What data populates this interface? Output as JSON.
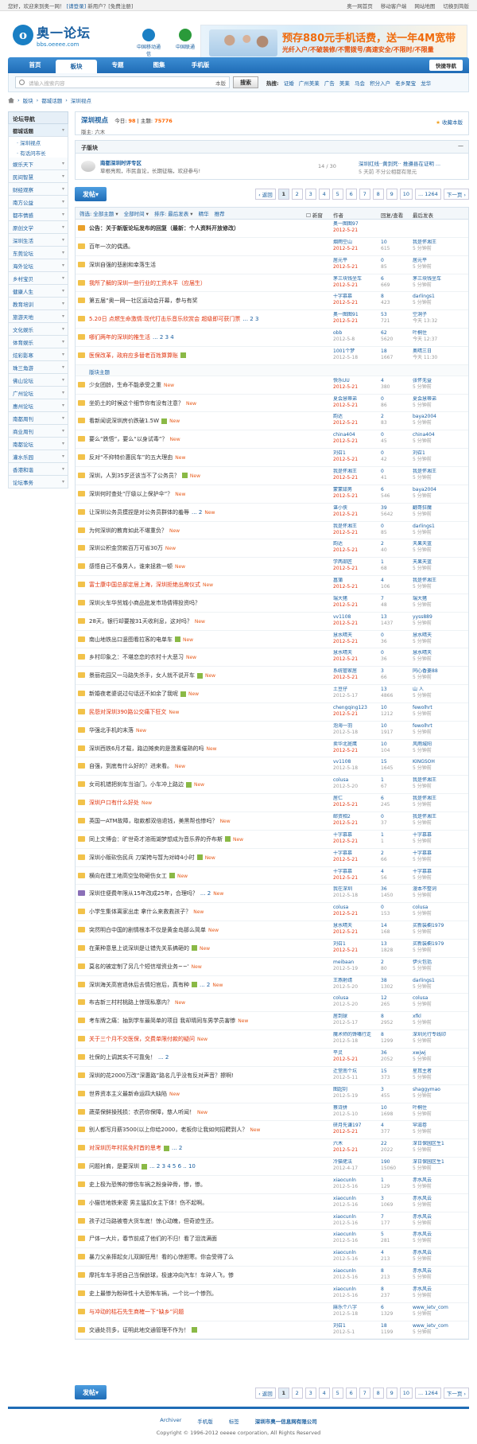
{
  "topbar": {
    "greeting": "您好，欢迎来到奥一网！",
    "login": "[请登录]",
    "new_user": "新用户？[免费注册]",
    "links": [
      "奥一网首页",
      "移动客户端",
      "网站地图",
      "切换到简版"
    ]
  },
  "logo": {
    "name": "奥一论坛",
    "url": "bbs.oeeee.com"
  },
  "partners": [
    "中国移动通信",
    "中国联通"
  ],
  "banner": {
    "line1": "预存880元手机话费，送一年4M宽带",
    "line2": "光纤入户/不破装修/不需拨号/高速安全/不限时/不限量"
  },
  "nav": {
    "items": [
      "首页",
      "板块",
      "专题",
      "图集",
      "手机版"
    ],
    "active": 1,
    "quick": "快捷导航"
  },
  "search": {
    "placeholder": "请输入搜索内容",
    "scope": "本版",
    "button": "搜索",
    "hot_label": "热搜:",
    "hot": [
      "证婚",
      "广州美莱",
      "广告",
      "美莱",
      "马会",
      "积分入户",
      "老乡聚宝",
      "龙华"
    ]
  },
  "breadcrumb": [
    "版块",
    "都城话题",
    "深圳视点"
  ],
  "sidebar": {
    "title": "论坛导航",
    "items": [
      {
        "label": "都城话题",
        "selected": true,
        "subs": [
          "深圳视点",
          "有话问市长"
        ]
      },
      {
        "label": "娱乐天下"
      },
      {
        "label": "民间智慧"
      },
      {
        "label": "财经观察"
      },
      {
        "label": "南方公益"
      },
      {
        "label": "都市情感"
      },
      {
        "label": "原创文学"
      },
      {
        "label": "深圳生活"
      },
      {
        "label": "东莞论坛"
      },
      {
        "label": "海外论坛"
      },
      {
        "label": "乡村宝贝"
      },
      {
        "label": "健康人生"
      },
      {
        "label": "教育培训"
      },
      {
        "label": "旅游天地"
      },
      {
        "label": "文化娱乐"
      },
      {
        "label": "体育娱乐"
      },
      {
        "label": "炫彩影寒"
      },
      {
        "label": "珠三角游"
      },
      {
        "label": "佛山论坛"
      },
      {
        "label": "广州论坛"
      },
      {
        "label": "惠州论坛"
      },
      {
        "label": "南都周刊"
      },
      {
        "label": "商业周刊"
      },
      {
        "label": "南都论坛"
      },
      {
        "label": "灌水乐园"
      },
      {
        "label": "香港和谐"
      },
      {
        "label": "论坛事务"
      }
    ]
  },
  "forum": {
    "title": "深圳视点",
    "today_label": "今日:",
    "today": "98",
    "topics_label": "主题:",
    "topics": "75776",
    "mods": "版主: 六木",
    "fav": "收藏本版"
  },
  "subforum": {
    "header": "子版块",
    "name": "南都深圳时评专区",
    "desc": "草根亮观，市民直论，长期征稿，欢迎参与!",
    "count": "14 / 30",
    "last1": "深圳红线··黄到死·· 推遵县在证明 ...",
    "last2": "5 天前 不分公相都有限元"
  },
  "post_btn": "发帖",
  "pager": [
    "‹ 返回",
    "1",
    "2",
    "3",
    "4",
    "5",
    "6",
    "7",
    "8",
    "9",
    "10",
    "... 1264",
    "下一页 ›"
  ],
  "filter": {
    "items": [
      "筛选: 全部主题",
      "全部时间",
      "排序: 最后发表",
      "精华",
      "推荐"
    ],
    "new_label": "新窗",
    "cols": [
      "作者",
      "回复/查看",
      "最后发表"
    ]
  },
  "divider": "版块主题",
  "threads": [
    {
      "title": "公告：关于新版论坛发布的回复（最新：个人资料开放修改）",
      "type": "ann",
      "bold": true,
      "author": "奥一图图97",
      "adate": "2012-5-21",
      "replies": "",
      "views": "",
      "last": "",
      "ltime": ""
    },
    {
      "title": "百年一次的偶遇。",
      "type": "normal",
      "author": "烟雨空山",
      "adate": "2012-5-21",
      "replies": "10",
      "views": "615",
      "last": "我是怀湘王",
      "ltime": "5 分钟前"
    },
    {
      "title": "深圳自强的悲剧和幸落生活",
      "type": "normal",
      "author": "居元平",
      "adate": "2012-5-21",
      "replies": "0",
      "views": "85",
      "last": "居元平",
      "ltime": "5 分钟前"
    },
    {
      "title": "我所了解的深圳一些行业的工资水平（应届生）",
      "type": "normal",
      "red": true,
      "author": "茅三块钱坐车",
      "adate": "2012-5-21",
      "replies": "6",
      "views": "669",
      "last": "茅三块钱坐车",
      "ltime": "5 分钟前"
    },
    {
      "title": "第五届“奥一网一社区运动会开幕，参与有奖",
      "type": "normal",
      "author": "十字慕慕",
      "adate": "2012-5-21",
      "replies": "8",
      "views": "423",
      "last": "darlings1",
      "ltime": "5 分钟前"
    },
    {
      "title": "5.20日 点燃生命激情:现代打击乐音乐欣赏会 超级即可获门票",
      "type": "normal",
      "red": true,
      "pages": "... 2 3",
      "author": "奥一图图91",
      "adate": "2012-5-21",
      "replies": "53",
      "views": "721",
      "last": "空洞子",
      "ltime": "今天 13:32"
    },
    {
      "title": "哪们两年的深圳的推生活",
      "type": "normal",
      "red": true,
      "pages": "... 2 3 4",
      "author": "obb",
      "adate": "2012-5-8",
      "replies": "62",
      "views": "5620",
      "last": "叶桐住",
      "ltime": "今天 12:37"
    },
    {
      "title": "医保改革，政府应多替老百姓算算账",
      "type": "normal",
      "red": true,
      "pic": true,
      "author": "1001个梦",
      "adate": "2012-5-18",
      "replies": "18",
      "views": "1667",
      "last": "奥晴三日",
      "ltime": "今天 11:30"
    },
    {
      "title": "少女团龄，生命不能承受之重",
      "type": "normal",
      "new": true,
      "author": "快乐UU",
      "adate": "2012-5-21",
      "replies": "4",
      "views": "380",
      "last": "张怀无益",
      "ltime": "5 分钟前"
    },
    {
      "title": "坐奶土的时候这个细节你有没有注意？",
      "type": "normal",
      "new": true,
      "author": "夏会慧蒂弟",
      "adate": "2012-5-21",
      "replies": "0",
      "views": "86",
      "last": "夏会慧蒂弟",
      "ltime": "5 分钟前"
    },
    {
      "title": "看新闻说深圳房价跌破1.5W",
      "type": "normal",
      "pic": true,
      "new": true,
      "author": "韵达",
      "adate": "2012-5-21",
      "replies": "2",
      "views": "83",
      "last": "baya2004",
      "ltime": "5 分钟前"
    },
    {
      "title": "要么“跌悟”，要么“以身试毒”？",
      "type": "normal",
      "new": true,
      "author": "china404",
      "adate": "2012-5-21",
      "replies": "0",
      "views": "45",
      "last": "china404",
      "ltime": "5 分钟前"
    },
    {
      "title": "反对“不抑特价惠民车”的五大理由",
      "type": "normal",
      "new": true,
      "author": "刘召1",
      "adate": "2012-5-21",
      "replies": "0",
      "views": "42",
      "last": "刘召1",
      "ltime": "5 分钟前"
    },
    {
      "title": "深圳，人到35岁还该当不了公务员？",
      "type": "normal",
      "pic": true,
      "new": true,
      "author": "我是怀湘王",
      "adate": "2012-5-21",
      "replies": "0",
      "views": "41",
      "last": "我是怀湘王",
      "ltime": "5 分钟前"
    },
    {
      "title": "深圳何时查处“厅级以上保护伞”？",
      "type": "normal",
      "new": true,
      "author": "蒙蒙甜男",
      "adate": "2012-5-21",
      "replies": "6",
      "views": "546",
      "last": "baya2004",
      "ltime": "5 分钟前"
    },
    {
      "title": "让深圳公务员摸捏是对公务员群体的羞辱",
      "type": "normal",
      "pages": "... 2",
      "new": true,
      "author": "谌小侠",
      "adate": "2012-5-21",
      "replies": "39",
      "views": "5642",
      "last": "翻哥狂魔",
      "ltime": "5 分钟前"
    },
    {
      "title": "为何深圳的教育如此不堪重负？",
      "type": "normal",
      "new": true,
      "author": "我是怀湘王",
      "adate": "2012-5-21",
      "replies": "0",
      "views": "85",
      "last": "darlings1",
      "ltime": "5 分钟前"
    },
    {
      "title": "深圳公积金贷款百万可省30万",
      "type": "normal",
      "new": true,
      "author": "韵达",
      "adate": "2012-5-21",
      "replies": "2",
      "views": "40",
      "last": "天果天蓝",
      "ltime": "5 分钟前"
    },
    {
      "title": "感悟自己不像男人，谁来拯救一顿",
      "type": "normal",
      "new": true,
      "author": "学两部匠",
      "adate": "2012-5-21",
      "replies": "1",
      "views": "68",
      "last": "天果天蓝",
      "ltime": "5 分钟前"
    },
    {
      "title": "富士康中国总部定居上海，深圳拒绝出席仪式",
      "type": "normal",
      "red": true,
      "new": true,
      "author": "菖蒲",
      "adate": "2012-5-21",
      "replies": "4",
      "views": "106",
      "last": "我是怀湘王",
      "ltime": "5 分钟前"
    },
    {
      "title": "深圳火车华贸城小商品批发市场倩得投资吗？",
      "type": "normal",
      "author": "瑞大猪",
      "adate": "2012-5-21",
      "replies": "7",
      "views": "48",
      "last": "瑞大猪",
      "ltime": "5 分钟前"
    },
    {
      "title": "28天，银行却要按31天收利息，这对吗？",
      "type": "normal",
      "new": true,
      "author": "vv1108",
      "adate": "2012-5-21",
      "replies": "13",
      "views": "1437",
      "last": "yyss889",
      "ltime": "5 分钟前"
    },
    {
      "title": "南山地铁出口竖图看拉客的电单车",
      "type": "normal",
      "pic": true,
      "new": true,
      "author": "慧水晴天",
      "adate": "2012-5-21",
      "replies": "0",
      "views": "36",
      "last": "慧水晴天",
      "ltime": "5 分钟前"
    },
    {
      "title": "乡村印象之：不堪恋恋的农村十大恶习",
      "type": "normal",
      "new": true,
      "author": "慧水晴天",
      "adate": "2012-5-21",
      "replies": "0",
      "views": "36",
      "last": "慧水晴天",
      "ltime": "5 分钟前"
    },
    {
      "title": "景丽花园又一马路失杀手，女人就不说开车",
      "type": "normal",
      "pic": true,
      "new": true,
      "author": "系统管家居",
      "adate": "2012-5-21",
      "replies": "3",
      "views": "66",
      "last": "同心香菱88",
      "ltime": "5 分钟前"
    },
    {
      "title": "新婚夜老婆说过句话还不如余了我呢",
      "type": "normal",
      "pic": true,
      "new": true,
      "author": "土豆仔",
      "adate": "2012-5-17",
      "replies": "13",
      "views": "4866",
      "last": "山 人",
      "ltime": "5 分钟前"
    },
    {
      "title": "民怨对深圳390路公交痛下狂文",
      "type": "normal",
      "red": true,
      "new": true,
      "author": "chengqing123",
      "adate": "2012-5-21",
      "replies": "10",
      "views": "1212",
      "last": "fewolhrt",
      "ltime": "5 分钟前"
    },
    {
      "title": "华强北手机的末落",
      "type": "normal",
      "new": true,
      "author": "泡海一羽",
      "adate": "2012-5-18",
      "replies": "10",
      "views": "1917",
      "last": "fewolhrt",
      "ltime": "5 分钟前"
    },
    {
      "title": "深圳西铁6月才载，路边摊卖的是激素催熟的吗",
      "type": "normal",
      "new": true,
      "author": "卖华北斑鹰",
      "adate": "2012-5-21",
      "replies": "10",
      "views": "104",
      "last": "风雨城阳",
      "ltime": "5 分钟前"
    },
    {
      "title": "自强，到底有什么好的？进来看。",
      "type": "normal",
      "new": true,
      "author": "vv1108",
      "adate": "2012-5-18",
      "replies": "15",
      "views": "1645",
      "last": "KINGSOH",
      "ltime": "5 分钟前"
    },
    {
      "title": "女司机错把刹车当油门，小车冲上路边",
      "type": "normal",
      "pic": true,
      "new": true,
      "author": "colusa",
      "adate": "2012-5-20",
      "replies": "1",
      "views": "67",
      "last": "我是怀湘王",
      "ltime": "5 分钟前"
    },
    {
      "title": "深圳户口有什么好处",
      "type": "normal",
      "red": true,
      "new": true,
      "author": "居仁",
      "adate": "2012-5-21",
      "replies": "6",
      "views": "245",
      "last": "我是怀湘王",
      "ltime": "5 分钟前"
    },
    {
      "title": "英国一ATM故障，取款都双倍退钱，美黑帮也惨吗？",
      "type": "normal",
      "new": true,
      "author": "邮资相2",
      "adate": "2012-5-21",
      "replies": "0",
      "views": "37",
      "last": "我是怀湘王",
      "ltime": "5 分钟前"
    },
    {
      "title": "同上文博会：旷世奇才溶雨湖梦想成为音乐界的乔布斯",
      "type": "normal",
      "pic": true,
      "new": true,
      "author": "十字慕慕",
      "adate": "2012-5-21",
      "replies": "1",
      "views": "1",
      "last": "十字慕慕",
      "ltime": "5 分钟前"
    },
    {
      "title": "深圳小贩砍伤民兵 刀架挎与暂为对峙4小时",
      "type": "normal",
      "pic": true,
      "new": true,
      "author": "十字慕慕",
      "adate": "2012-5-21",
      "replies": "2",
      "views": "66",
      "last": "十字慕慕",
      "ltime": "5 分钟前"
    },
    {
      "title": "横向在建工地高空坠物砸伤女工",
      "type": "normal",
      "pic": true,
      "new": true,
      "author": "十字慕慕",
      "adate": "2012-5-21",
      "replies": "4",
      "views": "56",
      "last": "十字慕慕",
      "ltime": "5 分钟前"
    },
    {
      "title": "深圳住便费年限从15年改成25年，合理吗？",
      "type": "vs",
      "pages": "... 2",
      "new": true,
      "author": "我在深圳",
      "adate": "2012-5-18",
      "replies": "36",
      "views": "1450",
      "last": "漫本不整词",
      "ltime": "5 分钟前"
    },
    {
      "title": "小学生集体离家出走 拿什么来救救孩子？",
      "type": "normal",
      "new": true,
      "author": "colusa",
      "adate": "2012-5-21",
      "replies": "0",
      "views": "153",
      "last": "colusa",
      "ltime": "5 分钟前"
    },
    {
      "title": "突然明白中国的剧情根本不仅是黄金岛那么简单",
      "type": "normal",
      "new": true,
      "author": "慧水晴天",
      "adate": "2012-5-21",
      "replies": "14",
      "views": "168",
      "last": "买新装橱1979",
      "ltime": "5 分钟前"
    },
    {
      "title": "在莱种意思上说深圳是让错先关系搞砸的",
      "type": "normal",
      "pic": true,
      "new": true,
      "author": "刘召1",
      "adate": "2012-5-21",
      "replies": "13",
      "views": "1828",
      "last": "买新装橱1979",
      "ltime": "5 分钟前"
    },
    {
      "title": "莫名的被定制了另几个短信增资业务~~'",
      "type": "normal",
      "new": true,
      "author": "meibaan",
      "adate": "2012-5-19",
      "replies": "2",
      "views": "80",
      "last": "伊火包括",
      "ltime": "5 分钟前"
    },
    {
      "title": "深圳海关高官退休后去情妇官后，真有种",
      "type": "normal",
      "pic": true,
      "pages": "... 2",
      "new": true,
      "author": "王燕射靖",
      "adate": "2012-5-20",
      "replies": "38",
      "views": "1302",
      "last": "darlings1",
      "ltime": "5 分钟前"
    },
    {
      "title": "布吉新三村村桃路上惊现私寨内？",
      "type": "normal",
      "new": true,
      "author": "colusa",
      "adate": "2012-5-20",
      "replies": "12",
      "views": "265",
      "last": "colusa",
      "ltime": "5 分钟前"
    },
    {
      "title": "考车牌之痛：抽到学车最简单的项目 我却晴同车男学员害惨",
      "type": "normal",
      "new": true,
      "author": "居到球",
      "adate": "2012-5-17",
      "replies": "8",
      "views": "2952",
      "last": "xfkl",
      "ltime": "5 分钟前"
    },
    {
      "title": "关于三个月不交医保，交费单限付款的疑问",
      "type": "normal",
      "red": true,
      "new": true,
      "author": "魔术师的馋嘴行走",
      "adate": "2012-5-18",
      "replies": "8",
      "views": "1299",
      "last": "深圳光行专线印",
      "ltime": "5 分钟前"
    },
    {
      "title": "社保的上调其实不可靠免！",
      "type": "normal",
      "pages": "... 2",
      "author": "平灵",
      "adate": "2012-5-21",
      "replies": "36",
      "views": "2052",
      "last": "xwjwj",
      "ltime": "5 分钟前"
    },
    {
      "title": "深圳的花2000万改“深惠路”路名几乎没有反对声音？擦啊!",
      "type": "normal",
      "author": "迁堂南个坑",
      "adate": "2012-5-11",
      "replies": "15",
      "views": "373",
      "last": "星耳主者",
      "ltime": "5 分钟前"
    },
    {
      "title": "世界资本主义最新命运四大缺陷",
      "type": "normal",
      "new": true,
      "author": "图超钊",
      "adate": "2012-5-19",
      "replies": "3",
      "views": "455",
      "last": "shaggymao",
      "ltime": "5 分钟前"
    },
    {
      "title": "蔬菜保鲜操残损：农药你保障，慈人听闻！",
      "type": "normal",
      "new": true,
      "author": "蔡诗拼",
      "adate": "2012-5-10",
      "replies": "10",
      "views": "1698",
      "last": "叶桐住",
      "ltime": "5 分钟前"
    },
    {
      "title": "别人都写月薪3500(以上你给2000，老板你让我如何招聘到人？",
      "type": "normal",
      "new": true,
      "author": "研月先谦197",
      "adate": "2012-5-21",
      "replies": "4",
      "views": "377",
      "last": "罕滋卷",
      "ltime": "5 分钟前"
    },
    {
      "title": "对深圳历年村民免村首的思考",
      "type": "normal",
      "red": true,
      "pic": true,
      "pages": "... 2",
      "author": "六木",
      "adate": "2012-5-21",
      "replies": "22",
      "views": "2022",
      "last": "深日保园区生1",
      "ltime": "5 分钟前"
    },
    {
      "title": "问题衬肩，是要深圳",
      "type": "normal",
      "pic": true,
      "pages": "... 2 3 4 5 6 .. 10",
      "author": "冷猫佬法",
      "adate": "2012-4-17",
      "replies": "190",
      "views": "15060",
      "last": "深日保园区生1",
      "ltime": "5 分钟前"
    },
    {
      "title": "史上极为恐怖的惨伤车祸之粉身碎骨，惨，惨。",
      "type": "normal",
      "author": "xiaocunln",
      "adate": "2012-5-16",
      "replies": "1",
      "views": "129",
      "last": "赤水风云",
      "ltime": "5 分钟前"
    },
    {
      "title": "小猫信地铁来密 男主猛扣女主下体！伤不起啊。",
      "type": "normal",
      "author": "xiaocunln",
      "adate": "2012-5-16",
      "replies": "3",
      "views": "1069",
      "last": "赤水风云",
      "ltime": "5 分钟前"
    },
    {
      "title": "孩子过马路被卷大货车底！惊心动魄，但奇迹生还。",
      "type": "normal",
      "author": "xiaocunln",
      "adate": "2012-5-16",
      "replies": "7",
      "views": "177",
      "last": "赤水风云",
      "ltime": "5 分钟前"
    },
    {
      "title": "尸体一大片，春节前成了他们的不归！看了泪流满面",
      "type": "normal",
      "author": "xiaocunln",
      "adate": "2012-5-16",
      "replies": "5",
      "views": "281",
      "last": "赤水风云",
      "ltime": "5 分钟前"
    },
    {
      "title": "暴力父亲摔起女儿双脚狂甩！看的心惊胆寒。你会受得了么",
      "type": "normal",
      "author": "xiaocunln",
      "adate": "2012-5-16",
      "replies": "4",
      "views": "213",
      "last": "赤水风云",
      "ltime": "5 分钟前"
    },
    {
      "title": "摩托车车手把自己当保龄球，极速冲向汽车！车碎人飞，惨",
      "type": "normal",
      "author": "xiaocunln",
      "adate": "2012-5-16",
      "replies": "8",
      "views": "213",
      "last": "赤水风云",
      "ltime": "5 分钟前"
    },
    {
      "title": "史上最惨为粉碎性十大恐怖车祸，一个比一个惨烈。",
      "type": "normal",
      "author": "xiaocunln",
      "adate": "2012-5-16",
      "replies": "8",
      "views": "237",
      "last": "赤水风云",
      "ltime": "5 分钟前"
    },
    {
      "title": "与冲动的枯石先生商榷一下“缺乡”问题",
      "type": "normal",
      "red": true,
      "author": "麻乐个八字",
      "adate": "2012-5-18",
      "replies": "6",
      "views": "1329",
      "last": "www_ietv_com",
      "ltime": "5 分钟前"
    },
    {
      "title": "交通处罚多，证明此地交通管理不作为！",
      "type": "normal",
      "pic": true,
      "author": "刘召1",
      "adate": "2012-5-1",
      "replies": "18",
      "views": "1199",
      "last": "www_ietv_com",
      "ltime": "5 分钟前"
    }
  ],
  "footer": {
    "links": [
      "Archiver",
      "手机版",
      "标签",
      "深圳市奥一信息网有限公司"
    ],
    "copyright": "Copyright © 1996-2012 oeeee corporation, All Rights Reserved"
  }
}
